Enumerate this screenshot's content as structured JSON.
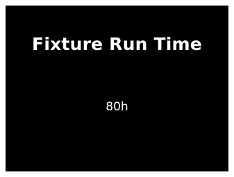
{
  "screen": {
    "title": "Fixture Run Time",
    "value": "80h",
    "background_color": "#000000",
    "text_color": "#ffffff"
  }
}
